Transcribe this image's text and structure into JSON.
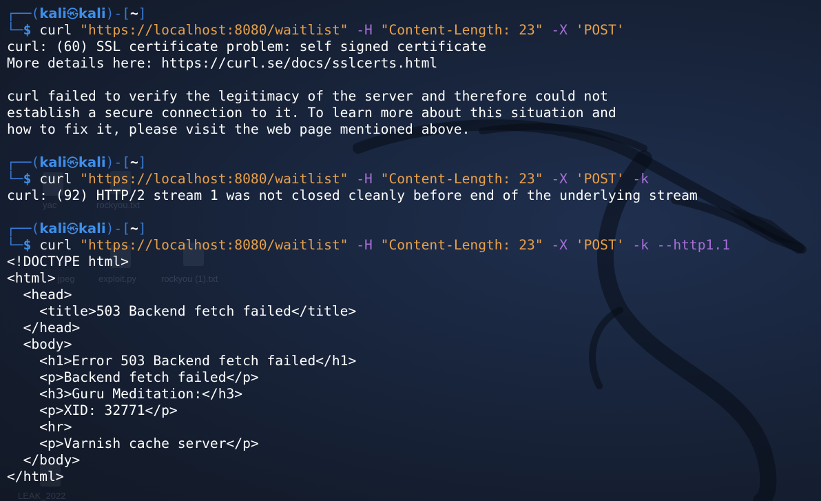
{
  "prompt": {
    "user": "kali",
    "host": "kali",
    "cwd": "~",
    "symbol": "$",
    "separator_icon": "kali-dragon-glyph"
  },
  "blocks": [
    {
      "command": [
        {
          "text": "curl",
          "kind": "cmd"
        },
        {
          "text": " ",
          "kind": "cmd"
        },
        {
          "text": "\"https://localhost:8080/waitlist\"",
          "kind": "str"
        },
        {
          "text": " ",
          "kind": "cmd"
        },
        {
          "text": "-H",
          "kind": "opt"
        },
        {
          "text": " ",
          "kind": "cmd"
        },
        {
          "text": "\"Content-Length: 23\"",
          "kind": "str"
        },
        {
          "text": " ",
          "kind": "cmd"
        },
        {
          "text": "-X",
          "kind": "opt"
        },
        {
          "text": " ",
          "kind": "cmd"
        },
        {
          "text": "'POST'",
          "kind": "str"
        }
      ],
      "output": [
        "curl: (60) SSL certificate problem: self signed certificate",
        "More details here: https://curl.se/docs/sslcerts.html",
        "",
        "curl failed to verify the legitimacy of the server and therefore could not",
        "establish a secure connection to it. To learn more about this situation and",
        "how to fix it, please visit the web page mentioned above.",
        ""
      ]
    },
    {
      "command": [
        {
          "text": "curl",
          "kind": "cmd"
        },
        {
          "text": " ",
          "kind": "cmd"
        },
        {
          "text": "\"https://localhost:8080/waitlist\"",
          "kind": "str"
        },
        {
          "text": " ",
          "kind": "cmd"
        },
        {
          "text": "-H",
          "kind": "opt"
        },
        {
          "text": " ",
          "kind": "cmd"
        },
        {
          "text": "\"Content-Length: 23\"",
          "kind": "str"
        },
        {
          "text": " ",
          "kind": "cmd"
        },
        {
          "text": "-X",
          "kind": "opt"
        },
        {
          "text": " ",
          "kind": "cmd"
        },
        {
          "text": "'POST'",
          "kind": "str"
        },
        {
          "text": " ",
          "kind": "cmd"
        },
        {
          "text": "-k",
          "kind": "opt"
        }
      ],
      "output": [
        "curl: (92) HTTP/2 stream 1 was not closed cleanly before end of the underlying stream",
        ""
      ]
    },
    {
      "command": [
        {
          "text": "curl",
          "kind": "cmd"
        },
        {
          "text": " ",
          "kind": "cmd"
        },
        {
          "text": "\"https://localhost:8080/waitlist\"",
          "kind": "str"
        },
        {
          "text": " ",
          "kind": "cmd"
        },
        {
          "text": "-H",
          "kind": "opt"
        },
        {
          "text": " ",
          "kind": "cmd"
        },
        {
          "text": "\"Content-Length: 23\"",
          "kind": "str"
        },
        {
          "text": " ",
          "kind": "cmd"
        },
        {
          "text": "-X",
          "kind": "opt"
        },
        {
          "text": " ",
          "kind": "cmd"
        },
        {
          "text": "'POST'",
          "kind": "str"
        },
        {
          "text": " ",
          "kind": "cmd"
        },
        {
          "text": "-k",
          "kind": "opt"
        },
        {
          "text": " ",
          "kind": "cmd"
        },
        {
          "text": "--http1.1",
          "kind": "opt"
        }
      ],
      "output": [
        "<!DOCTYPE html>",
        "<html>",
        "  <head>",
        "    <title>503 Backend fetch failed</title>",
        "  </head>",
        "  <body>",
        "    <h1>Error 503 Backend fetch failed</h1>",
        "    <p>Backend fetch failed</p>",
        "    <h3>Guru Meditation:</h3>",
        "    <p>XID: 32771</p>",
        "    <hr>",
        "    <p>Varnish cache server</p>",
        "  </body>",
        "</html>"
      ]
    }
  ],
  "desktop_icons": [
    {
      "label": "yac",
      "name": "desktop-icon-yac"
    },
    {
      "label": "rockyou.txt",
      "name": "desktop-icon-rockyou"
    },
    {
      "label": "jpeg",
      "name": "desktop-icon-jpeg"
    },
    {
      "label": "exploit.py",
      "name": "desktop-icon-exploit"
    },
    {
      "label": "rockyou (1).txt",
      "name": "desktop-icon-rockyou-1"
    },
    {
      "label": "LEAK_2022",
      "name": "desktop-icon-leak"
    }
  ],
  "colors": {
    "background": "#161f33",
    "prompt_frame": "#3a7bd5",
    "prompt_user": "#3f8ee8",
    "string": "#e8a14a",
    "option": "#a66fd6",
    "text": "#ffffff"
  }
}
